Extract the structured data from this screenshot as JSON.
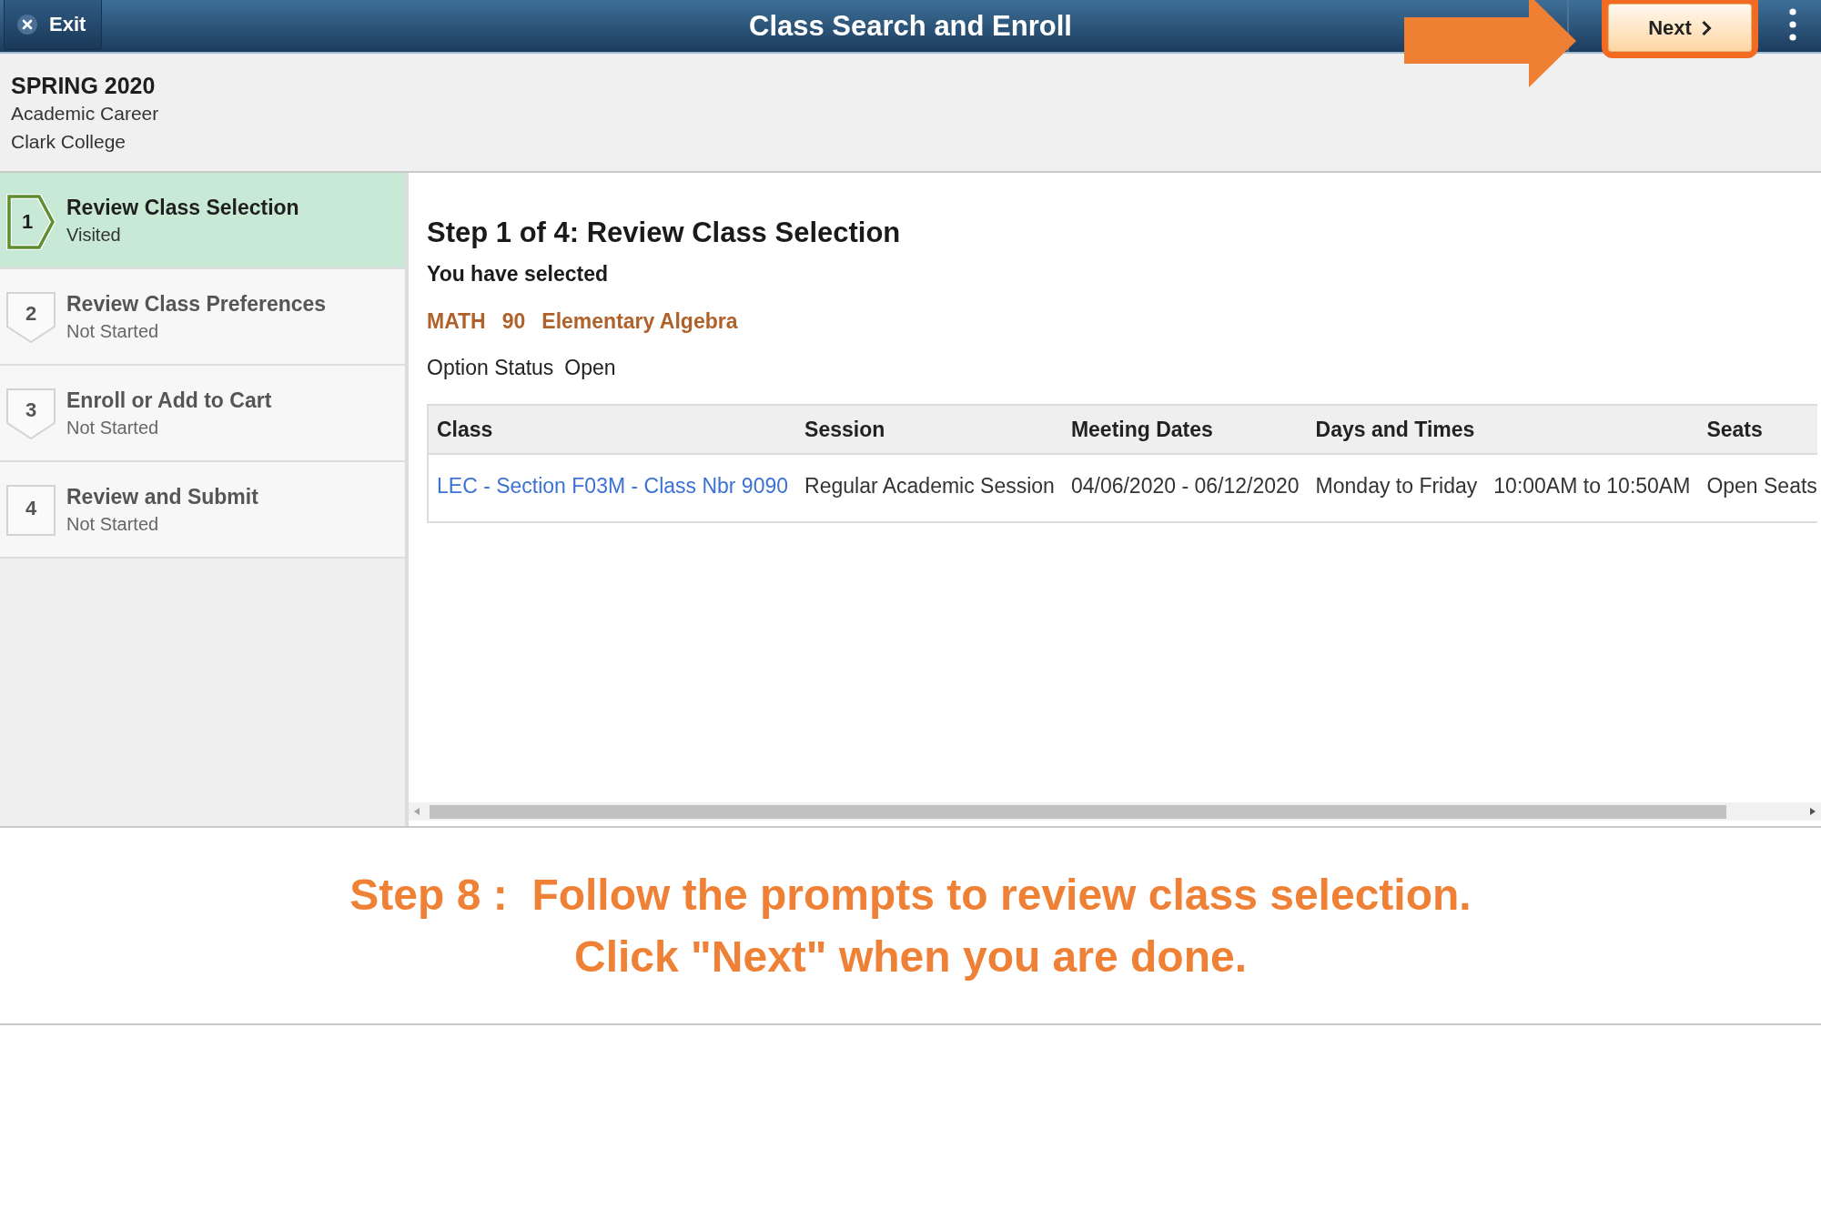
{
  "header": {
    "exit_label": "Exit",
    "title": "Class Search and Enroll",
    "next_label": "Next"
  },
  "term": {
    "name": "SPRING 2020",
    "career": "Academic Career",
    "institution": "Clark College"
  },
  "steps": [
    {
      "number": "1",
      "title": "Review Class Selection",
      "status": "Visited",
      "selected": true
    },
    {
      "number": "2",
      "title": "Review Class Preferences",
      "status": "Not Started",
      "selected": false
    },
    {
      "number": "3",
      "title": "Enroll or Add to Cart",
      "status": "Not Started",
      "selected": false
    },
    {
      "number": "4",
      "title": "Review and Submit",
      "status": "Not Started",
      "selected": false
    }
  ],
  "content": {
    "heading": "Step 1 of 4: Review Class Selection",
    "intro": "You have selected",
    "course": {
      "subject": "MATH",
      "number": "90",
      "title": "Elementary Algebra"
    },
    "option_status": {
      "label": "Option Status",
      "value": "Open"
    },
    "table": {
      "columns": [
        "Class",
        "Session",
        "Meeting Dates",
        "Days and Times",
        "Seats"
      ],
      "rows": [
        {
          "cells": [
            {
              "kind": "link",
              "parts": [
                "LEC - Section F03M - Class Nbr 9090"
              ]
            },
            {
              "kind": "text",
              "parts": [
                "Regular Academic Session"
              ]
            },
            {
              "kind": "text",
              "parts": [
                "04/06/2020 - 06/12/2020"
              ]
            },
            {
              "kind": "text",
              "parts": [
                "Monday to Friday",
                "10:00AM to 10:50AM"
              ]
            },
            {
              "kind": "text",
              "parts": [
                "Open Seats"
              ]
            }
          ]
        }
      ]
    }
  },
  "instruction": {
    "lines": [
      "Step 8 :  Follow the prompts to review class selection.",
      "Click \"Next\" when you are done."
    ]
  }
}
